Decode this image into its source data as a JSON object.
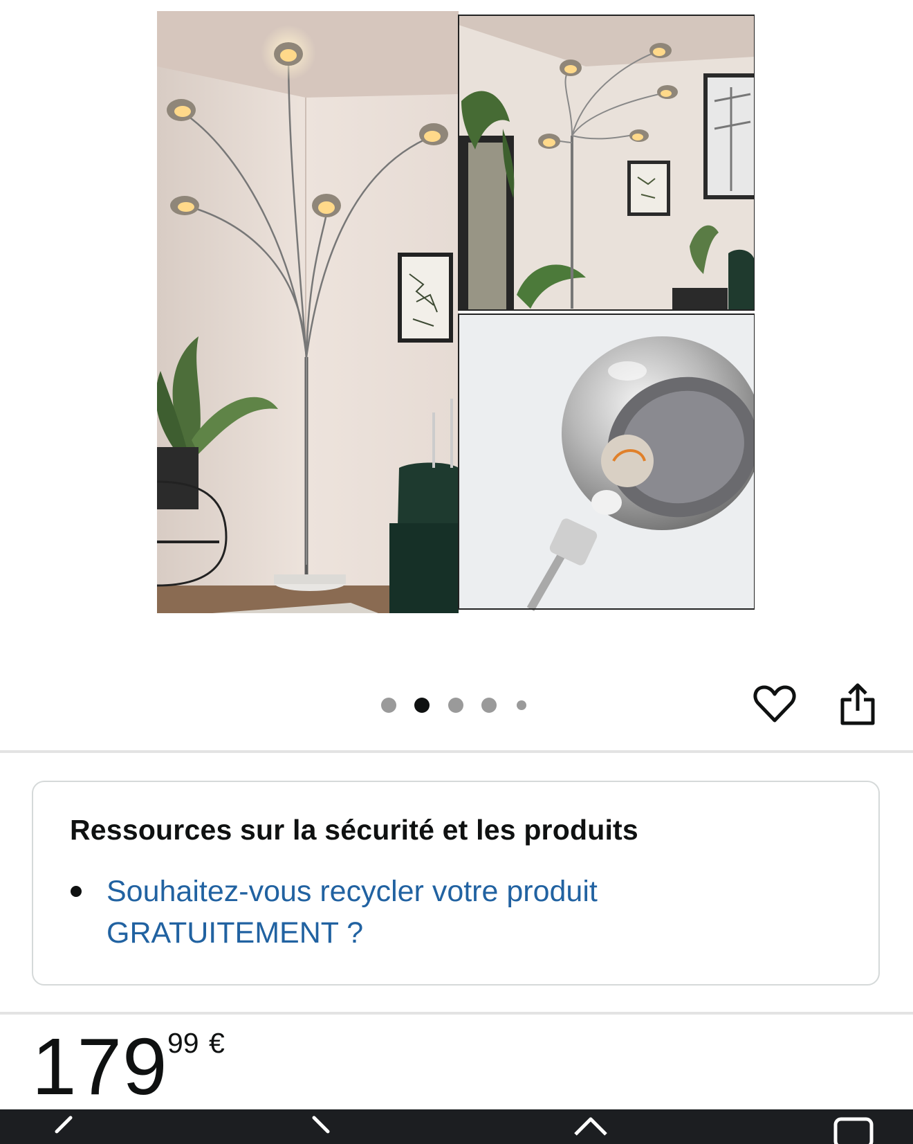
{
  "gallery": {
    "image_count": 5,
    "active_index": 1
  },
  "actions": {
    "wishlist_icon": "heart-icon",
    "share_icon": "share-icon"
  },
  "resources": {
    "title": "Ressources sur la sécurité et les produits",
    "link_line1": "Souhaitez-vous recycler votre produit",
    "link_line2": "GRATUITEMENT ?"
  },
  "price": {
    "whole": "179",
    "fraction": "99",
    "currency": "€"
  },
  "navbar": {
    "icons": [
      "back-icon",
      "forward-icon",
      "home-icon",
      "tabs-icon"
    ]
  },
  "colors": {
    "link": "#2162a1",
    "text": "#0f1111",
    "navbar": "#1c1e21"
  }
}
